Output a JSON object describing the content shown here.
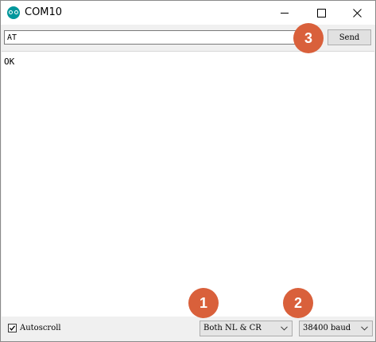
{
  "window": {
    "title": "COM10",
    "app_icon": "arduino-logo-icon",
    "controls": [
      "minimize-icon",
      "maximize-icon",
      "close-icon"
    ]
  },
  "input_row": {
    "command_value": "AT",
    "send_label": "Send"
  },
  "output": {
    "lines": [
      "OK"
    ]
  },
  "statusbar": {
    "autoscroll_label": "Autoscroll",
    "autoscroll_checked": true,
    "line_ending": "Both NL & CR",
    "baud_rate": "38400 baud"
  },
  "markers": {
    "m1": "1",
    "m2": "2",
    "m3": "3",
    "color": "#d9603b"
  }
}
